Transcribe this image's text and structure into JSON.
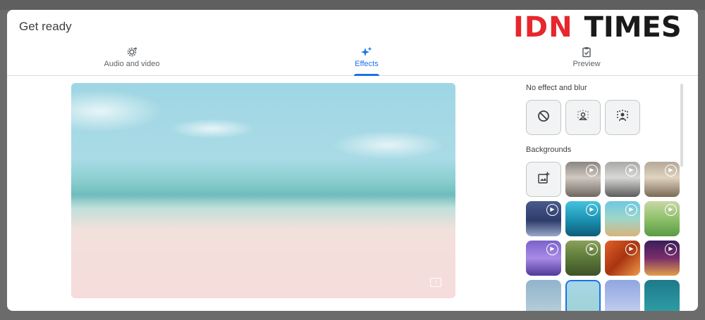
{
  "dialog": {
    "title": "Get ready"
  },
  "logo": {
    "part1": "IDN",
    "part2": "TIMES"
  },
  "tabs": [
    {
      "label": "Audio and video",
      "icon": "gear-icon",
      "active": false
    },
    {
      "label": "Effects",
      "icon": "sparkle-icon",
      "active": true
    },
    {
      "label": "Preview",
      "icon": "clipboard-check-icon",
      "active": false
    }
  ],
  "panel": {
    "no_effect_label": "No effect and blur",
    "backgrounds_label": "Backgrounds",
    "effects": [
      {
        "name": "no-effect",
        "icon": "block-icon"
      },
      {
        "name": "slight-blur",
        "icon": "person-blur-icon"
      },
      {
        "name": "blur",
        "icon": "person-blur-strong-icon"
      }
    ]
  },
  "colors": {
    "accent": "#1a73e8",
    "logo_red": "#e8262d"
  }
}
